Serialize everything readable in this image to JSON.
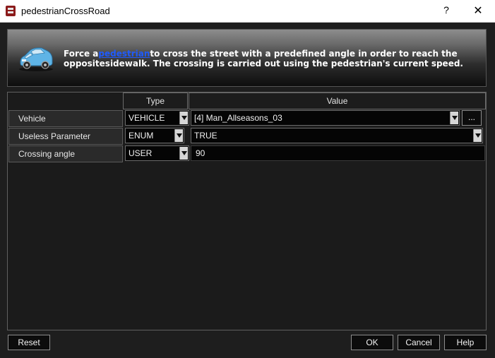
{
  "window": {
    "title": "pedestrianCrossRoad",
    "help_glyph": "?",
    "close_glyph": "✕"
  },
  "banner": {
    "icon": "car-icon",
    "text_before": "Force a",
    "link_text": "pedestrian",
    "text_after": "to cross the street with a predefined angle in order to reach the oppositesidewalk. The crossing is carried out using the pedestrian's current speed."
  },
  "table": {
    "headers": {
      "type": "Type",
      "value": "Value"
    },
    "rows": [
      {
        "label": "Vehicle",
        "type": "VEHICLE",
        "value": "[4] Man_Allseasons_03",
        "browse_label": "..."
      },
      {
        "label": "Useless Parameter",
        "type": "ENUM",
        "value": "TRUE"
      },
      {
        "label": "Crossing angle",
        "type": "USER",
        "value": "90"
      }
    ]
  },
  "buttons": {
    "reset": "Reset",
    "ok": "OK",
    "cancel": "Cancel",
    "help": "Help"
  },
  "colors": {
    "background": "#1e1e1e",
    "link": "#1f5bff"
  }
}
